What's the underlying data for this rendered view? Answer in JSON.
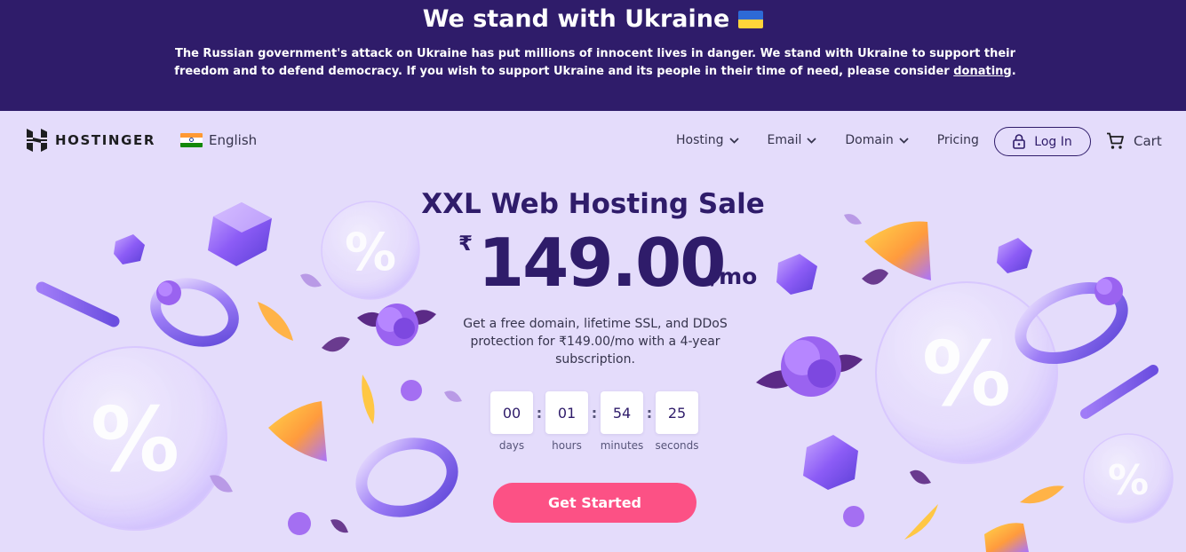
{
  "banner": {
    "title": "We stand with Ukraine",
    "text_prefix": "The Russian government's attack on Ukraine has put millions of innocent lives in danger. We stand with Ukraine to support their freedom and to defend democracy. If you wish to support Ukraine and its people in their time of need, please consider ",
    "link": "donating",
    "text_suffix": "."
  },
  "header": {
    "logo": "HOSTINGER",
    "language": "English",
    "nav": [
      {
        "label": "Hosting"
      },
      {
        "label": "Email"
      },
      {
        "label": "Domain"
      },
      {
        "label": "Pricing"
      }
    ],
    "login": "Log In",
    "cart": "Cart"
  },
  "hero": {
    "title": "XXL Web Hosting Sale",
    "currency": "₹",
    "price": "149.00",
    "per": "/mo",
    "description": "Get a free domain, lifetime SSL, and DDoS protection for ₹149.00/mo with a 4-year subscription.",
    "countdown": [
      {
        "value": "00",
        "label": "days"
      },
      {
        "value": "01",
        "label": "hours"
      },
      {
        "value": "54",
        "label": "minutes"
      },
      {
        "value": "25",
        "label": "seconds"
      }
    ],
    "cta": "Get Started"
  },
  "colors": {
    "banner_bg": "#2f1c6a",
    "page_bg": "#e4dcfb",
    "primary": "#2f1c6a",
    "cta": "#fc5185"
  },
  "icons": {
    "logo": "hostinger-logo-icon",
    "flag": "india-flag-icon",
    "dropdown": "chevron-down-icon",
    "login": "lock-icon",
    "cart": "cart-icon"
  }
}
